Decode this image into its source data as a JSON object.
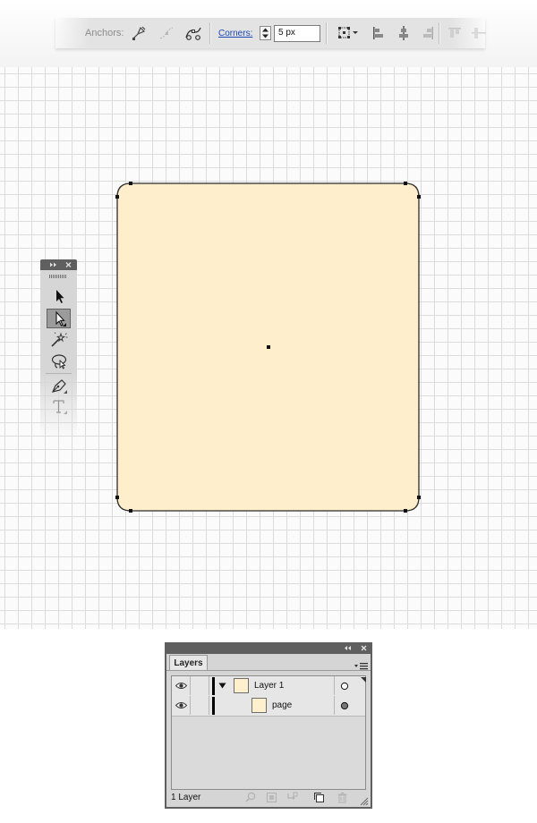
{
  "control_bar": {
    "anchors_label": "Anchors:",
    "corners_label": "Corners:",
    "corners_value": "5 px",
    "icons": [
      "convert-to-corner-icon",
      "convert-to-smooth-icon",
      "cut-path-at-anchor-icon",
      "transform-reference-icon",
      "align-left-icon",
      "align-horizontal-center-icon",
      "align-right-icon",
      "align-top-icon",
      "align-vertical-center-icon"
    ]
  },
  "artboard": {
    "shape": "rounded-rectangle",
    "fill": "#feeecb",
    "stroke": "#2b2b2b",
    "grid_color": "#dcdcdc"
  },
  "tools_panel": {
    "tools": [
      "selection-tool",
      "direct-selection-tool",
      "magic-wand-tool",
      "lasso-tool",
      "pen-tool",
      "type-tool"
    ],
    "active_tool": "direct-selection-tool"
  },
  "layers_panel": {
    "tab_label": "Layers",
    "layers": [
      {
        "name": "Layer 1",
        "expanded": true,
        "target": "hollow"
      },
      {
        "name": "page",
        "target": "filled"
      }
    ],
    "footer_label": "1 Layer",
    "footer_icons": [
      "locate-object-icon",
      "make-clipping-mask-icon",
      "create-sublayer-icon",
      "create-new-layer-icon",
      "delete-icon"
    ],
    "thumb_color": "#fef0cc"
  }
}
